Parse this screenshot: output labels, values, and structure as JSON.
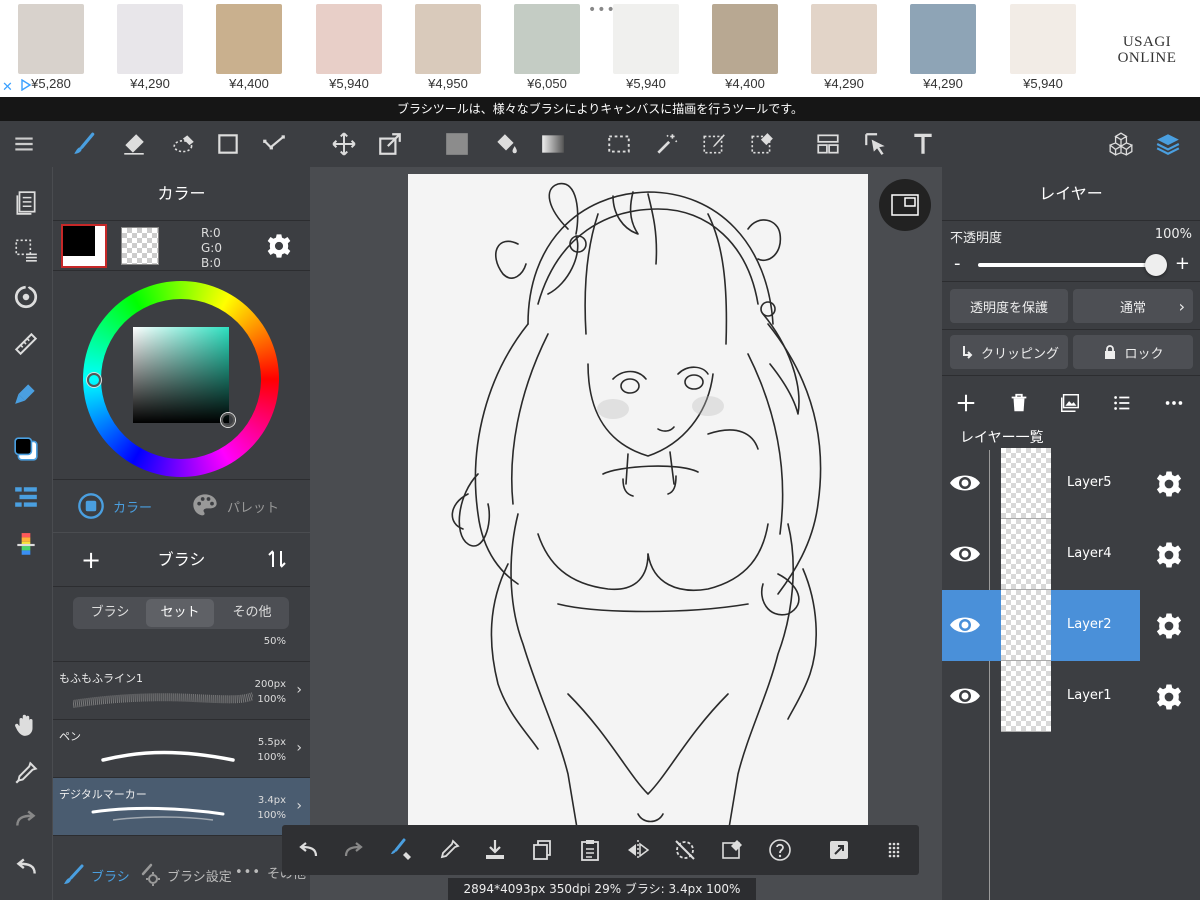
{
  "ad": {
    "items": [
      {
        "price": "¥5,280",
        "color": "#d8d2cc"
      },
      {
        "price": "¥4,290",
        "color": "#e8e6ea"
      },
      {
        "price": "¥4,400",
        "color": "#c9b08e"
      },
      {
        "price": "¥5,940",
        "color": "#e8cfc8"
      },
      {
        "price": "¥4,950",
        "color": "#d9cabb"
      },
      {
        "price": "¥6,050",
        "color": "#c4ccc4"
      },
      {
        "price": "¥5,940",
        "color": "#f0f0ee"
      },
      {
        "price": "¥4,400",
        "color": "#b8a892"
      },
      {
        "price": "¥4,290",
        "color": "#e2d4c8"
      },
      {
        "price": "¥4,290",
        "color": "#8ea4b6"
      },
      {
        "price": "¥5,940",
        "color": "#f2ece6"
      }
    ],
    "brand": "USAGI ONLINE",
    "close": "✕"
  },
  "hint": "ブラシツールは、様々なブラシによりキャンバスに描画を行うツールです。",
  "color_panel": {
    "title": "カラー",
    "r": "R:0",
    "g": "G:0",
    "b": "B:0",
    "tab_color": "カラー",
    "tab_palette": "パレット"
  },
  "brush_panel": {
    "title": "ブラシ",
    "add": "+",
    "segments": [
      "ブラシ",
      "セット",
      "その他"
    ],
    "partial_opacity": "50%",
    "items": [
      {
        "name": "もふもふライン1",
        "size": "200px",
        "opacity": "100%"
      },
      {
        "name": "ペン",
        "size": "5.5px",
        "opacity": "100%"
      },
      {
        "name": "デジタルマーカー",
        "size": "3.4px",
        "opacity": "100%"
      }
    ],
    "tab_brush": "ブラシ",
    "tab_settings": "ブラシ設定",
    "tab_other": "その他"
  },
  "status": "2894*4093px 350dpi 29% ブラシ: 3.4px 100%",
  "layer_panel": {
    "title": "レイヤー",
    "opacity_label": "不透明度",
    "opacity_value": "100%",
    "opacity_fraction": 1.0,
    "minus": "-",
    "plus": "+",
    "protect": "透明度を保護",
    "blend": "通常",
    "clipping": "クリッピング",
    "lock": "ロック",
    "list_title": "レイヤー一覧",
    "layers": [
      {
        "name": "Layer5",
        "selected": false
      },
      {
        "name": "Layer4",
        "selected": false
      },
      {
        "name": "Layer2",
        "selected": true
      },
      {
        "name": "Layer1",
        "selected": false
      }
    ]
  },
  "colors": {
    "accent": "#4a90d9",
    "panel": "#3c3e42",
    "foreground": "#000000"
  }
}
